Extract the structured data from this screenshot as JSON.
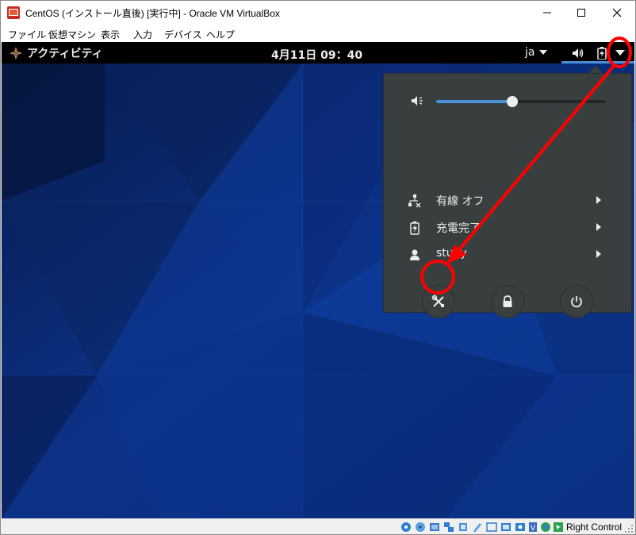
{
  "window": {
    "title": "CentOS (インストール直後) [実行中] - Oracle VM VirtualBox",
    "controls": [
      "minimize-icon",
      "maximize-icon",
      "close-icon"
    ]
  },
  "menubar": {
    "items": [
      "ファイル",
      "仮想マシン",
      "表示",
      "入力",
      "デバイス",
      "ヘルプ"
    ]
  },
  "topbar": {
    "activities_label": "アクティビティ",
    "clock": "4月11日  09：40",
    "input_method": "ja",
    "tray_icons": [
      "volume-icon",
      "battery-icon",
      "system-menu-arrow-icon"
    ]
  },
  "system_menu": {
    "volume_level": 0.45,
    "rows": [
      {
        "icon": "wired-network-off-icon",
        "label": "有線 オフ"
      },
      {
        "icon": "battery-charged-icon",
        "label": "充電完了"
      },
      {
        "icon": "user-icon",
        "label": "study"
      }
    ],
    "buttons": [
      "settings-icon",
      "lock-icon",
      "power-icon"
    ]
  },
  "statusbar": {
    "host_key": "Right Control"
  },
  "colors": {
    "accent": "#4a90d9",
    "annotation": "#ff0000",
    "popup_bg": "#393f3f",
    "topbar_bg": "#000000"
  }
}
